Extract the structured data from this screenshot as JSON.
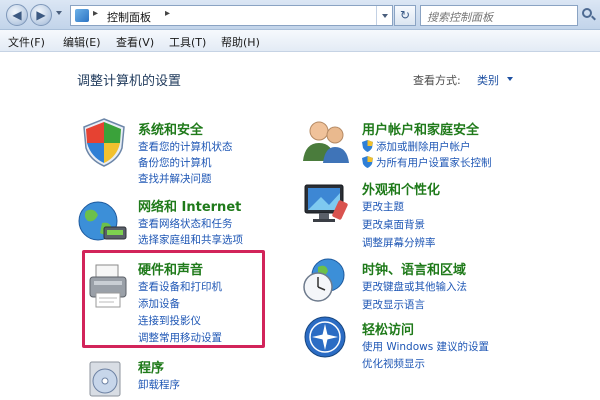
{
  "address": {
    "path": "控制面板"
  },
  "search": {
    "placeholder": "搜索控制面板"
  },
  "menu": [
    "文件(F)",
    "编辑(E)",
    "查看(V)",
    "工具(T)",
    "帮助(H)"
  ],
  "page": {
    "title": "调整计算机的设置",
    "view_label": "查看方式:",
    "view_value": "类别"
  },
  "categories": {
    "system": {
      "title": "系统和安全",
      "links": [
        "查看您的计算机状态",
        "备份您的计算机",
        "查找并解决问题"
      ]
    },
    "network": {
      "title": "网络和 Internet",
      "links": [
        "查看网络状态和任务",
        "选择家庭组和共享选项"
      ]
    },
    "hardware": {
      "title": "硬件和声音",
      "links": [
        "查看设备和打印机",
        "添加设备",
        "连接到投影仪",
        "调整常用移动设置"
      ]
    },
    "programs": {
      "title": "程序",
      "links": [
        "卸载程序"
      ]
    },
    "users": {
      "title": "用户帐户和家庭安全",
      "links": [
        "添加或删除用户帐户",
        "为所有用户设置家长控制"
      ]
    },
    "appearance": {
      "title": "外观和个性化",
      "links": [
        "更改主题",
        "更改桌面背景",
        "调整屏幕分辨率"
      ]
    },
    "clock": {
      "title": "时钟、语言和区域",
      "links": [
        "更改键盘或其他输入法",
        "更改显示语言"
      ]
    },
    "ease": {
      "title": "轻松访问",
      "links": [
        "使用 Windows 建议的设置",
        "优化视频显示"
      ]
    }
  },
  "colors": {
    "category_title": "#1f7a1a",
    "link": "#1f57b5",
    "highlight": "#d2245a"
  }
}
